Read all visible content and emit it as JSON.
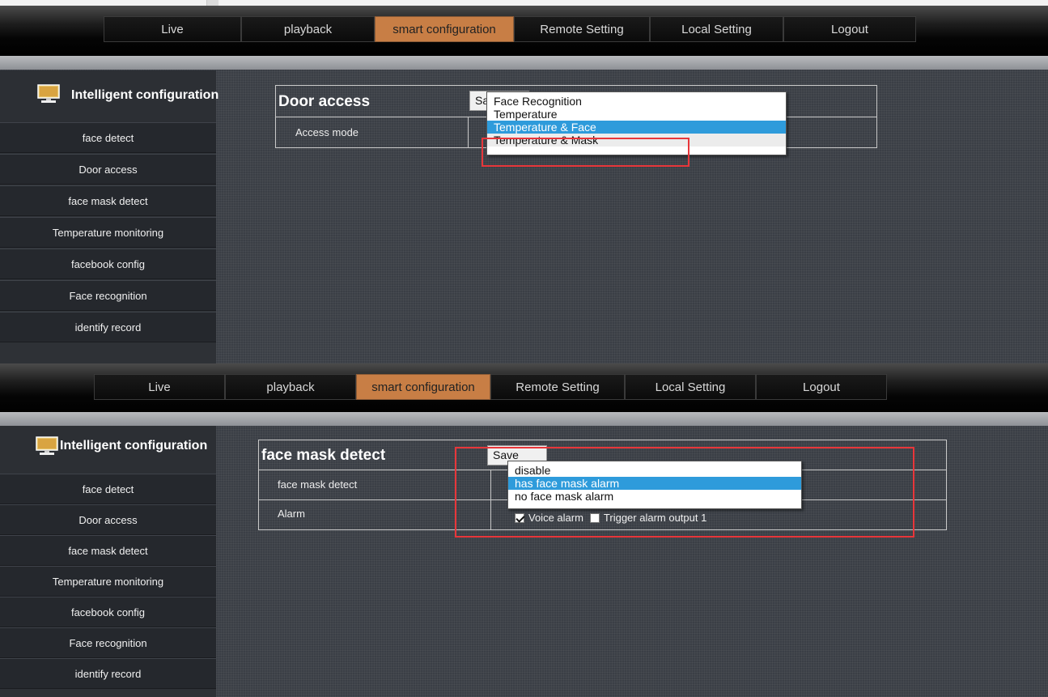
{
  "nav": {
    "items": [
      "Live",
      "playback",
      "smart configuration",
      "Remote Setting",
      "Local Setting",
      "Logout"
    ],
    "active": "smart configuration"
  },
  "sidebar": {
    "header": "Intelligent configuration",
    "icon": "monitor-icon",
    "items": [
      "face detect",
      "Door access",
      "face mask detect",
      "Temperature monitoring",
      "facebook config",
      "Face recognition",
      "identify record"
    ]
  },
  "panel1": {
    "title": "Door access",
    "save_label": "Save",
    "row_label": "Access mode",
    "dropdown": {
      "options": [
        "Face Recognition",
        "Temperature",
        "Temperature & Face",
        "Temperature & Mask"
      ],
      "highlighted": "Temperature & Face"
    }
  },
  "panel2": {
    "title": "face mask detect",
    "save_label": "Save",
    "row1_label": "face mask detect",
    "row2_label": "Alarm",
    "dropdown": {
      "options": [
        "disable",
        "has face mask alarm",
        "no face mask alarm"
      ],
      "highlighted": "has face mask alarm"
    },
    "voice_alarm_label": "Voice alarm",
    "voice_alarm_checked": true,
    "trigger_label": "Trigger alarm output 1",
    "trigger_checked": false
  },
  "colors": {
    "active_tab": "#c87e45",
    "highlight": "#2e9bdb",
    "annotation": "#e8363a"
  }
}
